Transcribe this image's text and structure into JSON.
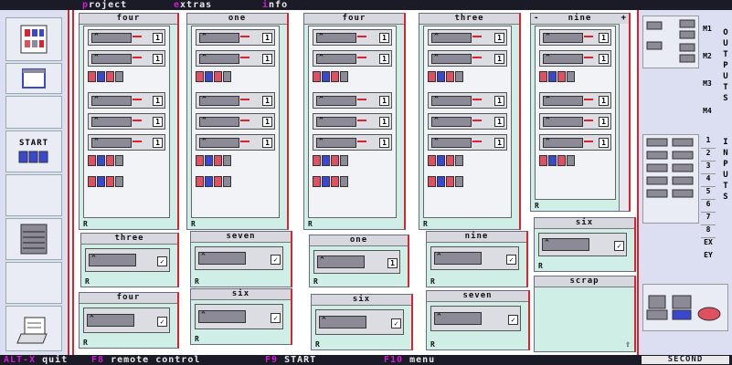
{
  "menu": [
    {
      "hot": "p",
      "rest": "roject"
    },
    {
      "hot": "e",
      "rest": "xtras"
    },
    {
      "hot": "i",
      "rest": "nfo"
    }
  ],
  "status": {
    "items": [
      {
        "key": "ALT-X",
        "label": "quit"
      },
      {
        "key": "F8",
        "label": "remote control"
      },
      {
        "key": "F9",
        "label": "START"
      },
      {
        "key": "F10",
        "label": "menu"
      }
    ],
    "mode": "SECOND"
  },
  "left_toolbox": {
    "start_label": "START"
  },
  "panels": {
    "top": [
      {
        "title": "four",
        "foot": "R"
      },
      {
        "title": "one",
        "foot": "R"
      },
      {
        "title": "four",
        "foot": "R"
      },
      {
        "title": "three",
        "foot": "R"
      },
      {
        "title": "nine",
        "foot": "R",
        "scroll_top": "-",
        "scroll_right": "+"
      }
    ],
    "mid": [
      {
        "title": "three",
        "foot": "R"
      },
      {
        "title": "seven",
        "foot": "R"
      },
      {
        "title": "one",
        "foot": "R"
      },
      {
        "title": "nine",
        "foot": "R"
      },
      {
        "title": "six",
        "foot": "R"
      }
    ],
    "bottom": [
      {
        "title": "four",
        "foot": "R"
      },
      {
        "title": "six",
        "foot": "R"
      },
      {
        "title": "six",
        "foot": "R"
      },
      {
        "title": "seven",
        "foot": "R"
      },
      {
        "title": "scrap",
        "foot": ""
      }
    ]
  },
  "block_numbers": [
    "1",
    "1",
    "1",
    "1",
    "1",
    "1",
    "1"
  ],
  "right_panel": {
    "outputs_label": "OUTPUTS",
    "outputs": [
      "M1",
      "M2",
      "M3",
      "M4"
    ],
    "inputs_label": "INPUTS",
    "inputs": [
      "1",
      "2",
      "3",
      "4",
      "5",
      "6",
      "7",
      "8"
    ],
    "extra": [
      "EX",
      "EY"
    ]
  },
  "colors": {
    "menubar": "#1b1b28",
    "hotkey": "#d21ad2",
    "panel_bg": "#cfeee6",
    "border_red": "#e0202a",
    "bar_gray": "#8b8a96"
  }
}
